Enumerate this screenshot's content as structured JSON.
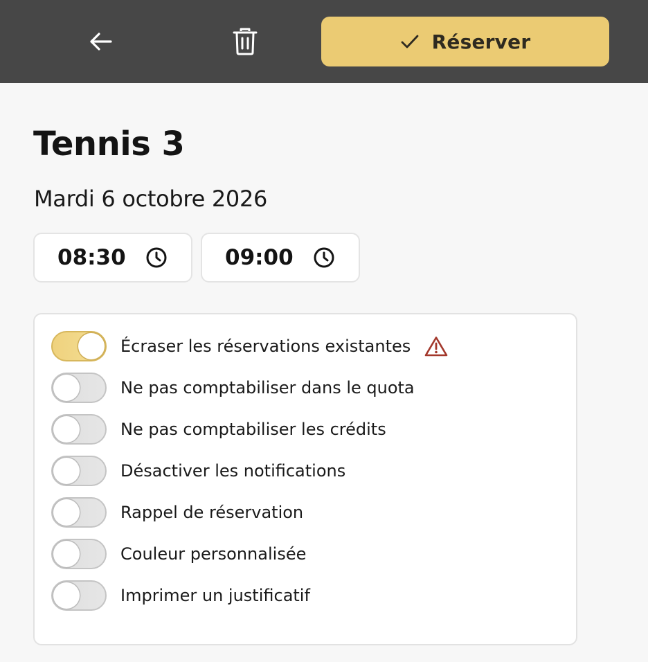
{
  "header": {
    "back_icon": "arrow-left-icon",
    "delete_icon": "trash-icon",
    "reserve": {
      "icon": "check-icon",
      "label": "Réserver"
    },
    "colors": {
      "bar": "#474747",
      "accent": "#ebcb73"
    }
  },
  "booking": {
    "title": "Tennis 3",
    "date": "Mardi 6 octobre 2026",
    "start_time": "08:30",
    "end_time": "09:00",
    "time_icon": "clock-icon"
  },
  "options": [
    {
      "label": "Écraser les réservations existantes",
      "enabled": true,
      "warning_icon": "warning-triangle-icon",
      "warning_color": "#a3382c"
    },
    {
      "label": "Ne pas comptabiliser dans le quota",
      "enabled": false
    },
    {
      "label": "Ne pas comptabiliser les crédits",
      "enabled": false
    },
    {
      "label": "Désactiver les notifications",
      "enabled": false
    },
    {
      "label": "Rappel de réservation",
      "enabled": false
    },
    {
      "label": "Couleur personnalisée",
      "enabled": false
    },
    {
      "label": "Imprimer un justificatif",
      "enabled": false
    }
  ]
}
